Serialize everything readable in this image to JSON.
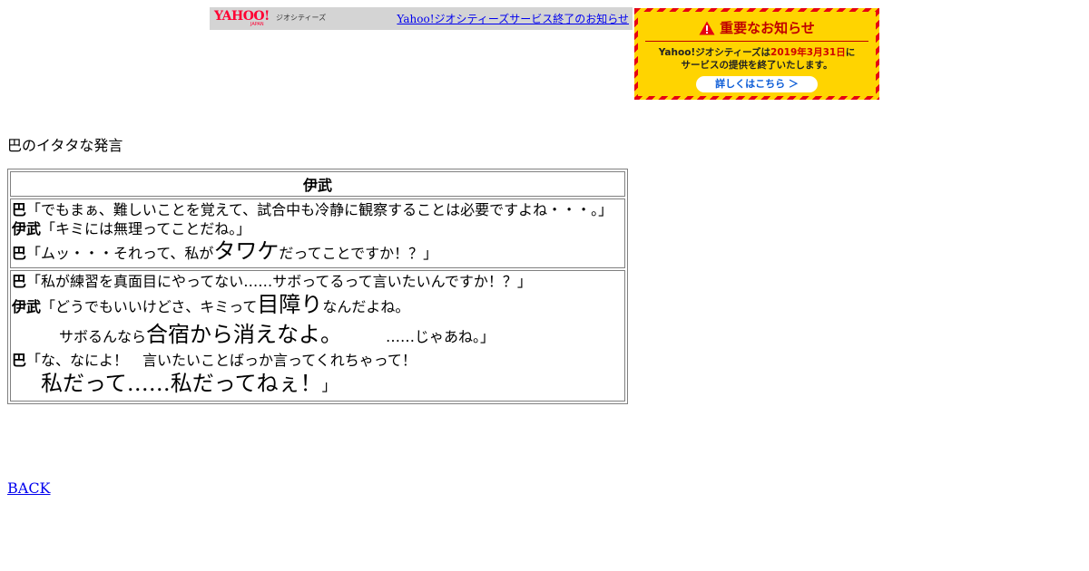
{
  "topbar": {
    "logo_main": "YAHOO!",
    "logo_sub": "JAPAN",
    "logo_geo": "ジオシティーズ",
    "link": "Yahoo!ジオシティーズサービス終了のお知らせ"
  },
  "banner": {
    "title": "重要なお知らせ",
    "line1_pre": "Yahoo!ジオシティーズは",
    "line1_date": "2019年3月31日",
    "line1_post": "に",
    "line2": "サービスの提供を終了いたします。",
    "button": "詳しくはこちら ＞",
    "colors": {
      "stripe_red": "#e60012",
      "stripe_yellow": "#ffd400",
      "title_red": "#c00000",
      "button_text": "#0a5bd6"
    }
  },
  "heading": "巴のイタタな発言",
  "table": {
    "header": "伊武",
    "row1": {
      "l1_speaker": "巴",
      "l1_text": "「でもまぁ、難しいことを覚えて、試合中も冷静に観察することは必要ですよね・・・。」",
      "l2_speaker": "伊武",
      "l2_text": "「キミには無理ってことだね。」",
      "l3_speaker": "巴",
      "l3_pre": "「ムッ・・・それって、私が",
      "l3_big": "タワケ",
      "l3_post": "だってことですか！？」"
    },
    "row2": {
      "l1_speaker": "巴",
      "l1_text": "「私が練習を真面目にやってない……サボってるって言いたいんですか！？」",
      "l2_speaker": "伊武",
      "l2_pre": "「どうでもいいけどさ、キミって",
      "l2_big": "目障り",
      "l2_post": "なんだよね。",
      "l3_pre": "サボるんなら",
      "l3_big": "合宿から消えなよ。",
      "l3_post": "……じゃあね。」",
      "l4_speaker": "巴",
      "l4_text": "「な、なによ！　言いたいことばっか言ってくれちゃって！",
      "l5_big": "私だって……私だってねぇ！",
      "l5_post": "」"
    }
  },
  "back_link": "BACK"
}
